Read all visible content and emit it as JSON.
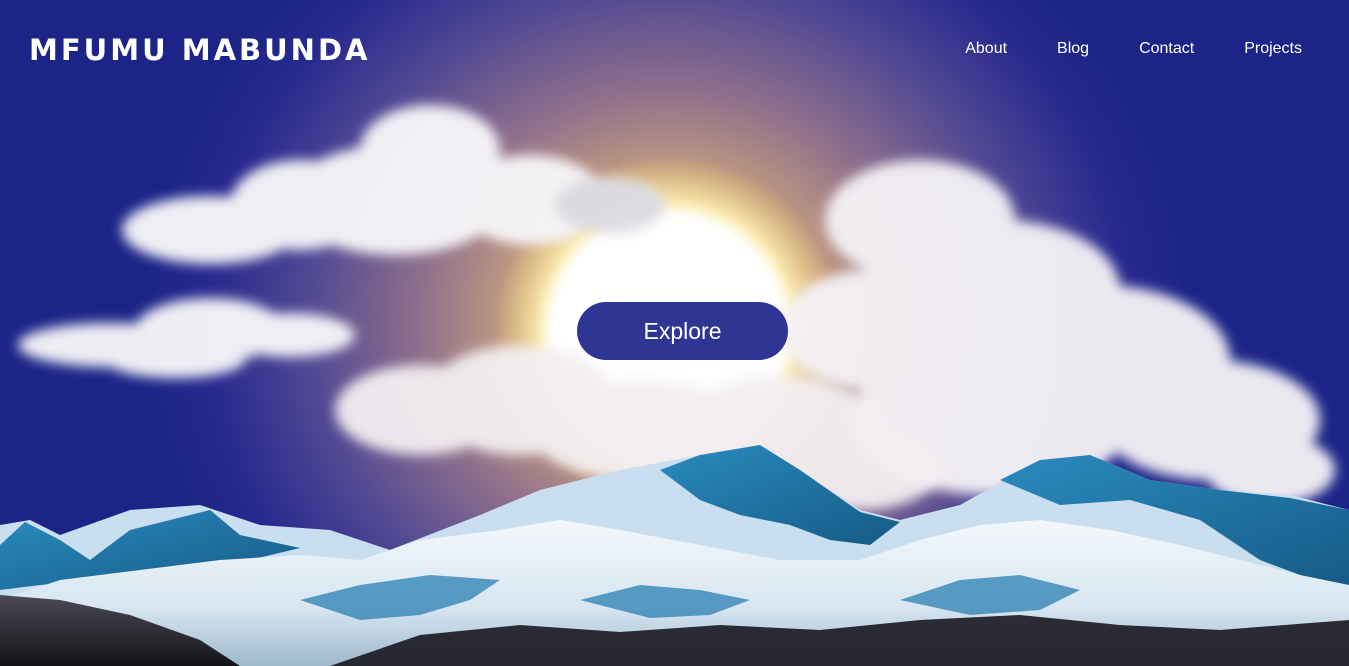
{
  "header": {
    "site_title": "MFUMU MABUNDA"
  },
  "nav": {
    "items": [
      {
        "label": "About"
      },
      {
        "label": "Blog"
      },
      {
        "label": "Contact"
      },
      {
        "label": "Projects"
      }
    ]
  },
  "hero": {
    "cta_label": "Explore"
  },
  "colors": {
    "sky_dark": "#1c2587",
    "sky_glow": "#f3d98a",
    "sun": "#ffffff",
    "button": "#2f3592",
    "text": "#ffffff",
    "snow": "#eef4fa",
    "mountain_shadow": "#1f6e9e"
  }
}
